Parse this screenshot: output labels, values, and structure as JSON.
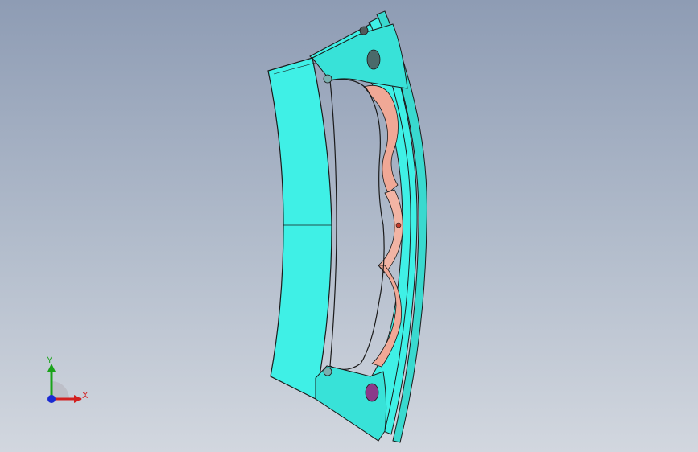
{
  "viewport": {
    "background_top": "#8e9cb4",
    "background_bottom": "#d2d7df"
  },
  "model": {
    "part_color": "#3ff0e6",
    "cut_face_color": "#f0a896",
    "edge_color": "#1a1a1a"
  },
  "triad": {
    "x_label": "X",
    "y_label": "Y",
    "x_color": "#d22020",
    "y_color": "#1aa31a",
    "z_color": "#1a2ad2"
  }
}
